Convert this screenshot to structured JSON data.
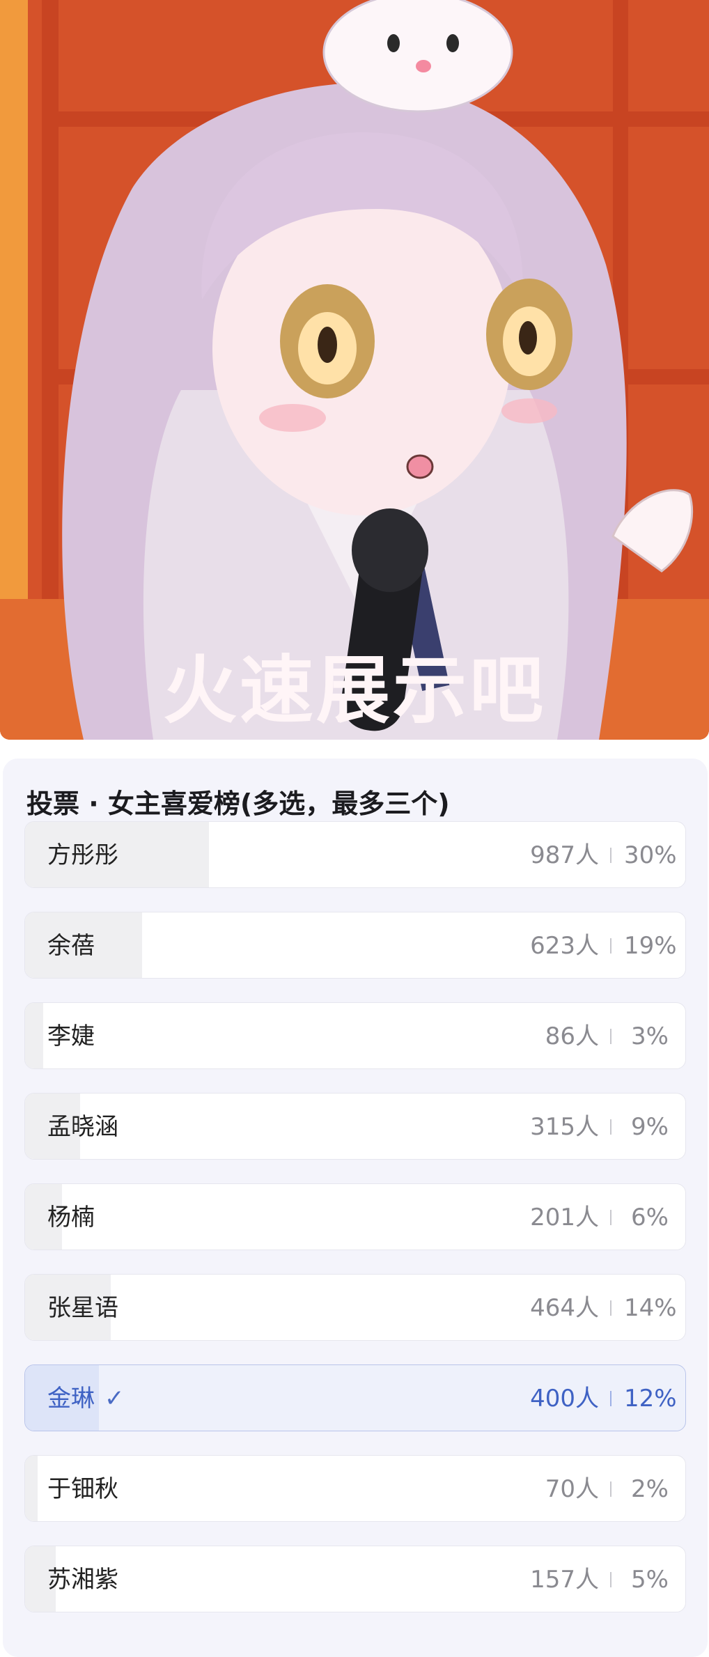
{
  "image": {
    "caption": "火速展示吧"
  },
  "poll": {
    "title": "投票 · 女主喜爱榜(多选，最多三个)",
    "options": [
      {
        "name": "方彤彤",
        "votes": "987人",
        "percent": "30%",
        "share": 0.3,
        "selected": false
      },
      {
        "name": "余蓓",
        "votes": "623人",
        "percent": "19%",
        "share": 0.19,
        "selected": false
      },
      {
        "name": "李婕",
        "votes": "86人",
        "percent": "3%",
        "share": 0.03,
        "selected": false
      },
      {
        "name": "孟晓涵",
        "votes": "315人",
        "percent": "9%",
        "share": 0.09,
        "selected": false
      },
      {
        "name": "杨楠",
        "votes": "201人",
        "percent": "6%",
        "share": 0.06,
        "selected": false
      },
      {
        "name": "张星语",
        "votes": "464人",
        "percent": "14%",
        "share": 0.14,
        "selected": false
      },
      {
        "name": "金琳",
        "votes": "400人",
        "percent": "12%",
        "share": 0.12,
        "selected": true
      },
      {
        "name": "于钿秋",
        "votes": "70人",
        "percent": "2%",
        "share": 0.02,
        "selected": false
      },
      {
        "name": "苏湘紫",
        "votes": "157人",
        "percent": "5%",
        "share": 0.05,
        "selected": false
      }
    ]
  },
  "colors": {
    "accent": "#3f62c4",
    "card_bg": "#f4f4fb",
    "bar_fill": "#efeff1"
  },
  "icons": {
    "selected": "checkmark-icon"
  }
}
